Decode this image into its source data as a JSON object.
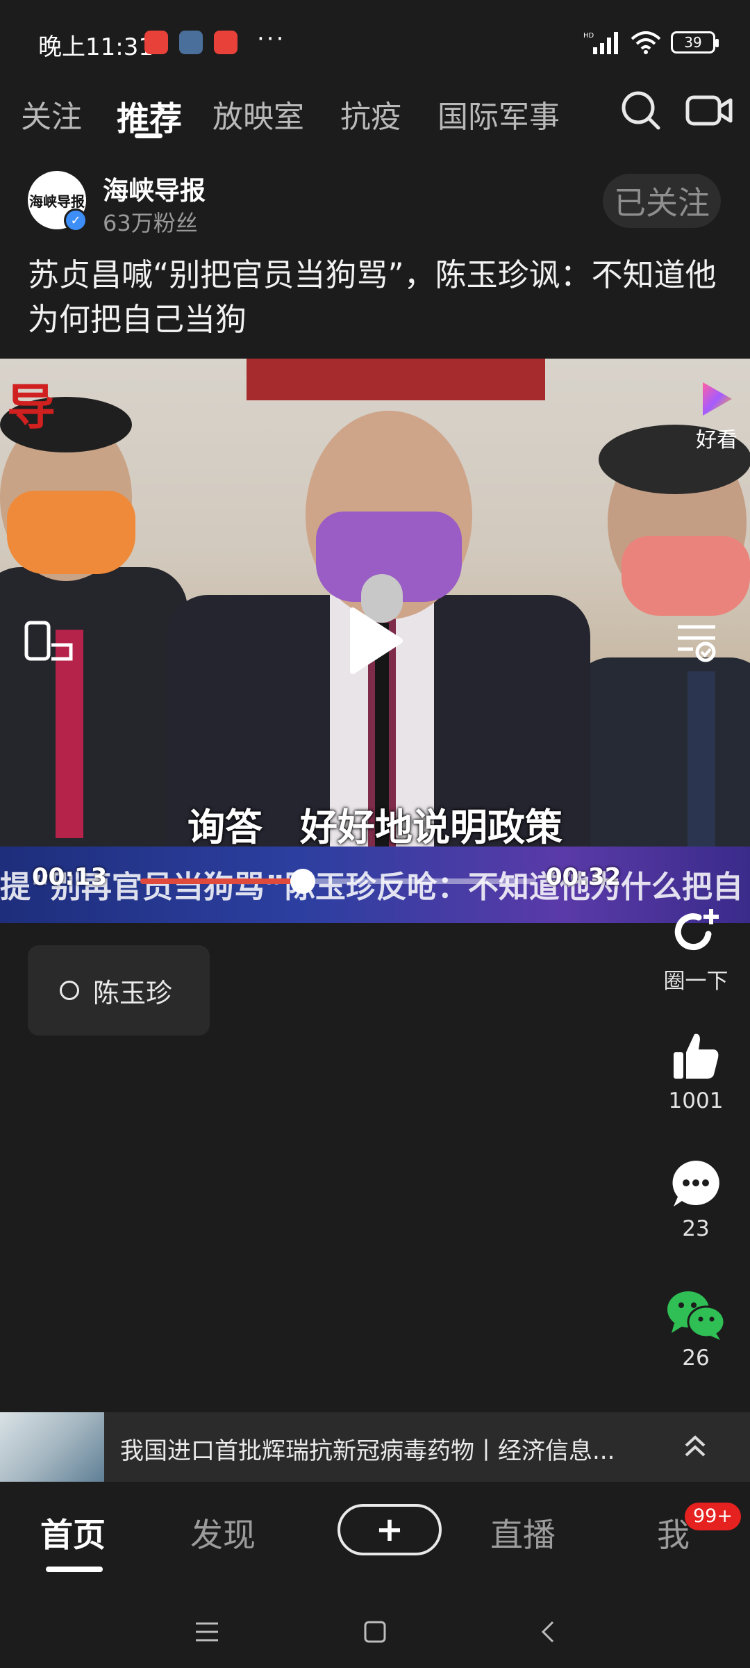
{
  "status_bar": {
    "time": "晚上11:31",
    "more": "···",
    "battery": "39"
  },
  "top_tabs": [
    {
      "label": "关注",
      "active": false
    },
    {
      "label": "推荐",
      "active": true
    },
    {
      "label": "放映室",
      "active": false
    },
    {
      "label": "抗疫",
      "active": false
    },
    {
      "label": "国际军事",
      "active": false
    }
  ],
  "author": {
    "avatar_text": "海峡导报",
    "name": "海峡导报",
    "fans": "63万粉丝",
    "follow_label": "已关注"
  },
  "video": {
    "title": "苏贞昌喊“别把官员当狗骂”，陈玉珍讽：不知道他为何把自己当狗",
    "watermark": "导",
    "platform_label": "好看",
    "subtitle": "询答　好好地说明政策",
    "ticker_text": "提“别再官员当狗骂”陈玉珍反呛：不知道他为什么把自",
    "current_time": "00:13",
    "total_time": "00:32",
    "progress": 0.41
  },
  "topic": {
    "label": "陈玉珍"
  },
  "actions": {
    "circle_label": "圈一下",
    "like_count": "1001",
    "comment_count": "23",
    "share_count": "26"
  },
  "related": {
    "title": "我国进口首批辉瑞抗新冠病毒药物丨经济信息..."
  },
  "bottom_nav": {
    "home": "首页",
    "discover": "发现",
    "plus": "+",
    "live": "直播",
    "me": "我",
    "badge": "99+"
  },
  "colors": {
    "background": "#1c1c1c",
    "accent_red": "#e04a3c",
    "badge_red": "#e5221f",
    "wechat_green": "#2fbf54"
  }
}
